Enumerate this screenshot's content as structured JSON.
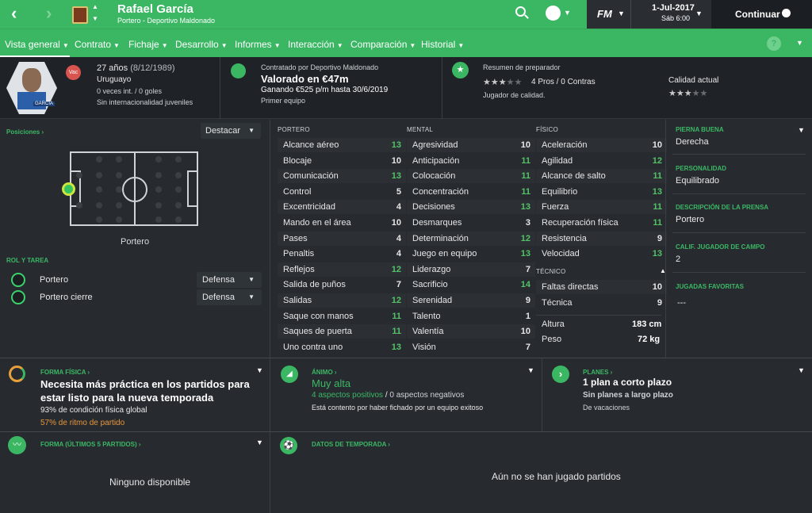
{
  "topbar": {
    "player_name": "Rafael García",
    "subtitle": "Portero - Deportivo Maldonado",
    "date": "1-Jul-2017",
    "time": "Sáb 6:00",
    "continue_label": "Continuar",
    "fm_label": "FM"
  },
  "nav": [
    "Vista general",
    "Contrato",
    "Fichaje",
    "Desarrollo",
    "Informes",
    "Interacción",
    "Comparación",
    "Historial"
  ],
  "help_label": "?",
  "profile": {
    "age_line": "27 años",
    "dob": "(8/12/1989)",
    "nationality": "Uruguayo",
    "caps": "0 veces int. / 0 goles",
    "youth": "Sin internacionalidad juveniles",
    "badge_vac": "Vac",
    "photo_name": "GARCÍA"
  },
  "contract": {
    "line1": "Contratado por Deportivo Maldonado",
    "value": "Valorado en €47m",
    "wage": "Ganando €525 p/m hasta 30/6/2019",
    "squad": "Primer equipo"
  },
  "coach": {
    "title": "Resumen de preparador",
    "stars": 3,
    "pros_cons": "4 Pros / 0 Contras",
    "desc": "Jugador de calidad.",
    "quality_title": "Calidad actual",
    "quality_stars": 3
  },
  "positions": {
    "title": "Posiciones",
    "dropdown": "Destacar",
    "label": "Portero"
  },
  "roles": {
    "title": "ROL Y TAREA",
    "items": [
      {
        "name": "Portero",
        "duty": "Defensa"
      },
      {
        "name": "Portero cierre",
        "duty": "Defensa"
      }
    ]
  },
  "attrs": {
    "gk_title": "PORTERO",
    "mental_title": "MENTAL",
    "phys_title": "FÍSICO",
    "tech_title": "TÉCNICO",
    "gk": [
      [
        "Alcance aéreo",
        13
      ],
      [
        "Blocaje",
        10
      ],
      [
        "Comunicación",
        13
      ],
      [
        "Control",
        5
      ],
      [
        "Excentricidad",
        4
      ],
      [
        "Mando en el área",
        10
      ],
      [
        "Pases",
        4
      ],
      [
        "Penaltis",
        4
      ],
      [
        "Reflejos",
        12
      ],
      [
        "Salida de puños",
        7
      ],
      [
        "Salidas",
        12
      ],
      [
        "Saque con manos",
        11
      ],
      [
        "Saques de puerta",
        11
      ],
      [
        "Uno contra uno",
        13
      ]
    ],
    "mental": [
      [
        "Agresividad",
        10
      ],
      [
        "Anticipación",
        11
      ],
      [
        "Colocación",
        11
      ],
      [
        "Concentración",
        11
      ],
      [
        "Decisiones",
        13
      ],
      [
        "Desmarques",
        3
      ],
      [
        "Determinación",
        12
      ],
      [
        "Juego en equipo",
        13
      ],
      [
        "Liderazgo",
        7
      ],
      [
        "Sacrificio",
        14
      ],
      [
        "Serenidad",
        9
      ],
      [
        "Talento",
        1
      ],
      [
        "Valentía",
        10
      ],
      [
        "Visión",
        7
      ]
    ],
    "phys": [
      [
        "Aceleración",
        10
      ],
      [
        "Agilidad",
        12
      ],
      [
        "Alcance de salto",
        11
      ],
      [
        "Equilibrio",
        13
      ],
      [
        "Fuerza",
        11
      ],
      [
        "Recuperación física",
        11
      ],
      [
        "Resistencia",
        9
      ],
      [
        "Velocidad",
        13
      ]
    ],
    "tech": [
      [
        "Faltas directas",
        10
      ],
      [
        "Técnica",
        9
      ]
    ],
    "height_label": "Altura",
    "height": "183 cm",
    "weight_label": "Peso",
    "weight": "72 kg"
  },
  "side": [
    {
      "label": "PIERNA BUENA",
      "value": "Derecha"
    },
    {
      "label": "PERSONALIDAD",
      "value": "Equilibrado"
    },
    {
      "label": "DESCRIPCIÓN DE LA PRENSA",
      "value": "Portero"
    },
    {
      "label": "CALIF. JUGADOR DE CAMPO",
      "value": "2"
    },
    {
      "label": "JUGADAS FAVORITAS",
      "value": "---"
    }
  ],
  "fitness": {
    "title": "FORMA FÍSICA",
    "headline": "Necesita más práctica en los partidos para estar listo para la nueva temporada",
    "cond": "93% de condición física global",
    "match": "57% de ritmo de partido"
  },
  "morale": {
    "title": "ÁNIMO",
    "value": "Muy alta",
    "pos": "4 aspectos positivos",
    "sep": "/",
    "neg": "0 aspectos negativos",
    "desc": "Está contento por haber fichado por un equipo exitoso"
  },
  "plans": {
    "title": "PLANES",
    "short": "1 plan a corto plazo",
    "long": "Sin planes a largo plazo",
    "holiday": "De vacaciones"
  },
  "form": {
    "title": "FORMA (ÚLTIMOS 5 PARTIDOS)",
    "empty": "Ninguno disponible"
  },
  "season": {
    "title": "DATOS DE TEMPORADA",
    "empty": "Aún no se han jugado partidos"
  }
}
